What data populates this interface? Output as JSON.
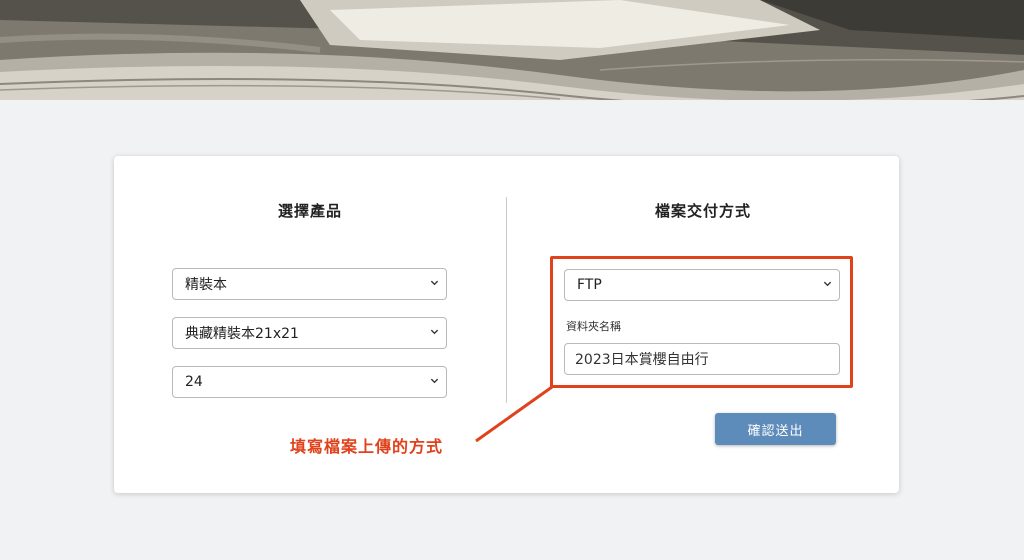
{
  "left_column": {
    "title": "選擇產品",
    "product_select": {
      "value": "精裝本"
    },
    "variant_select": {
      "value": "典藏精裝本21x21"
    },
    "pages_select": {
      "value": "24"
    }
  },
  "right_column": {
    "title": "檔案交付方式",
    "delivery_select": {
      "value": "FTP"
    },
    "folder_label": "資料夾名稱",
    "folder_input": {
      "value": "2023日本賞櫻自由行"
    },
    "submit_label": "確認送出"
  },
  "annotation": {
    "text": "填寫檔案上傳的方式",
    "color": "#e0421c"
  },
  "colors": {
    "accent": "#5d8cba",
    "highlight": "#e0421c",
    "background": "#f1f2f4"
  },
  "icons": {
    "select_chevron": "chevron-down-icon"
  }
}
